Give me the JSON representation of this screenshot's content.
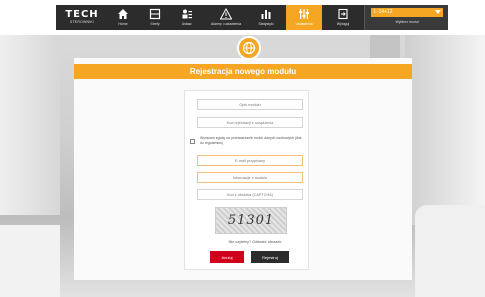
{
  "colors": {
    "accent": "#f5a623",
    "nav_bg": "#2c2c2c",
    "cancel": "#d0021b",
    "register": "#2c2c2c"
  },
  "brand": {
    "logo_main": "TECH",
    "logo_sub": "STEROWNIKI"
  },
  "nav": {
    "items": [
      {
        "label": "Home",
        "icon": "home-icon"
      },
      {
        "label": "Strefy",
        "icon": "zones-icon"
      },
      {
        "label": "Ustaw.",
        "icon": "settings-sliders-icon"
      },
      {
        "label": "Alarmy i ustawienia",
        "icon": "alarm-icon"
      },
      {
        "label": "Statystyki",
        "icon": "stats-icon"
      },
      {
        "label": "Ustawienia",
        "icon": "settings-icon"
      },
      {
        "label": "Wyloguj",
        "icon": "logout-icon"
      }
    ],
    "active_index": 5,
    "module_select": {
      "value": "L-14+12",
      "sub_label": "Wybierz moduł"
    }
  },
  "modal": {
    "title": "Rejestracja nowego modułu",
    "fields": [
      {
        "placeholder": "Opis modułu"
      },
      {
        "placeholder": "Kod rejestracji z urządzenia"
      },
      {
        "placeholder": "E-mail przypisany"
      },
      {
        "placeholder": "Informacje o module"
      },
      {
        "placeholder": "Kod z obrazka (CAPTCHA)"
      }
    ],
    "consent_text": "Wyrażam zgodę na przetwarzanie moich danych osobowych (link do regulaminu)",
    "captcha_text": "51301",
    "refresh_text": "Nie czytelny? Odśwież obrazek",
    "buttons": {
      "cancel": "Anuluj",
      "register": "Rejestruj"
    }
  }
}
